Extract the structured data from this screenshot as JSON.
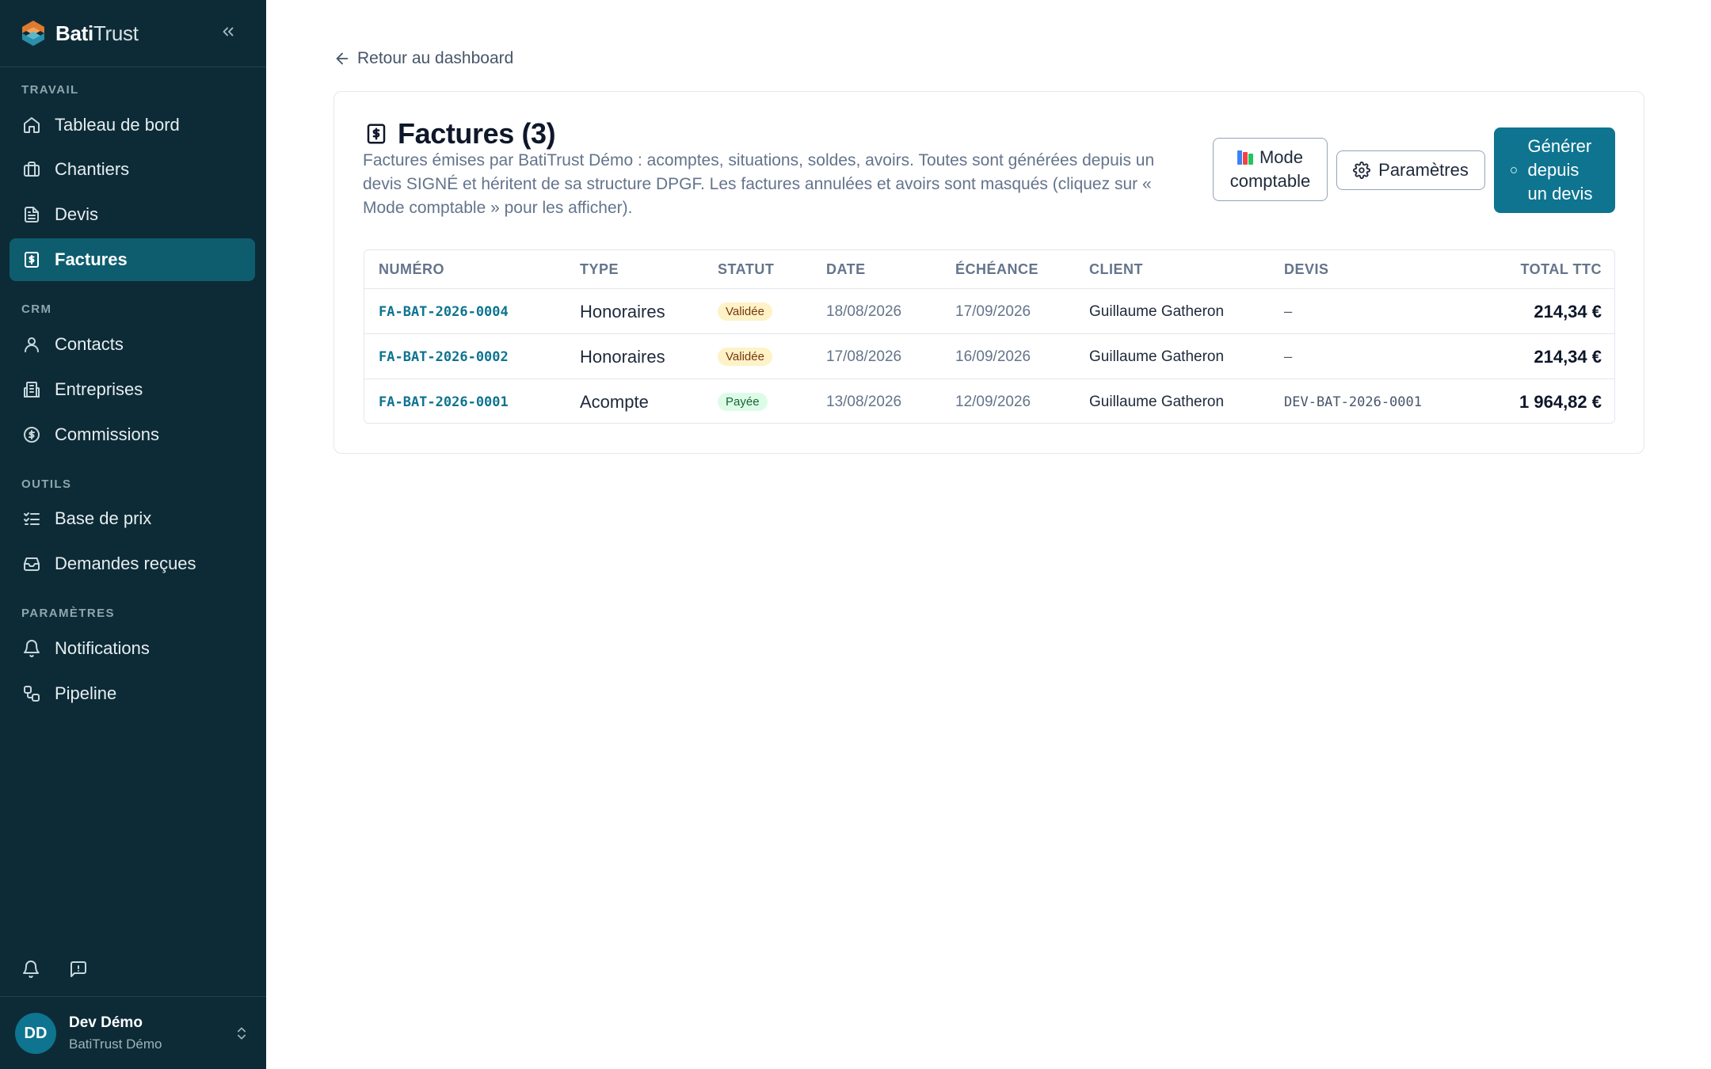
{
  "brand": {
    "name_bold": "Bati",
    "name_light": "Trust"
  },
  "sidebar": {
    "sections": [
      {
        "title": "TRAVAIL",
        "items": [
          {
            "label": "Tableau de bord",
            "icon": "home-icon"
          },
          {
            "label": "Chantiers",
            "icon": "briefcase-icon"
          },
          {
            "label": "Devis",
            "icon": "document-icon"
          },
          {
            "label": "Factures",
            "icon": "receipt-icon",
            "active": true
          }
        ]
      },
      {
        "title": "CRM",
        "items": [
          {
            "label": "Contacts",
            "icon": "user-icon"
          },
          {
            "label": "Entreprises",
            "icon": "building-icon"
          },
          {
            "label": "Commissions",
            "icon": "dollar-circle-icon"
          }
        ]
      },
      {
        "title": "OUTILS",
        "items": [
          {
            "label": "Base de prix",
            "icon": "list-checks-icon"
          },
          {
            "label": "Demandes reçues",
            "icon": "inbox-icon"
          }
        ]
      },
      {
        "title": "PARAMÈTRES",
        "items": [
          {
            "label": "Notifications",
            "icon": "bell-icon"
          },
          {
            "label": "Pipeline",
            "icon": "workflow-icon"
          }
        ]
      }
    ],
    "user": {
      "initials": "DD",
      "name": "Dev Démo",
      "org": "BatiTrust Démo"
    }
  },
  "main": {
    "back_label": "Retour au dashboard",
    "title": "Factures (3)",
    "description": "Factures émises par BatiTrust Démo : acomptes, situations, soldes, avoirs. Toutes sont générées depuis un devis SIGNÉ et héritent de sa structure DPGF. Les factures annulées et avoirs sont masqués (cliquez sur « Mode comptable » pour les afficher).",
    "buttons": {
      "mode_line1": "Mode",
      "mode_line2": "comptable",
      "params": "Paramètres",
      "generate": "Générer depuis un devis"
    },
    "table": {
      "headers": {
        "numero": "NUMÉRO",
        "type": "TYPE",
        "statut": "STATUT",
        "date": "DATE",
        "echeance": "ÉCHÉANCE",
        "client": "CLIENT",
        "devis": "DEVIS",
        "total": "TOTAL TTC"
      },
      "rows": [
        {
          "numero": "FA-BAT-2026-0004",
          "type": "Honoraires",
          "statut": "Validée",
          "statut_kind": "validee",
          "date": "18/08/2026",
          "echeance": "17/09/2026",
          "client": "Guillaume Gatheron",
          "devis": "–",
          "total": "214,34 €"
        },
        {
          "numero": "FA-BAT-2026-0002",
          "type": "Honoraires",
          "statut": "Validée",
          "statut_kind": "validee",
          "date": "17/08/2026",
          "echeance": "16/09/2026",
          "client": "Guillaume Gatheron",
          "devis": "–",
          "total": "214,34 €"
        },
        {
          "numero": "FA-BAT-2026-0001",
          "type": "Acompte",
          "statut": "Payée",
          "statut_kind": "payee",
          "date": "13/08/2026",
          "echeance": "12/09/2026",
          "client": "Guillaume Gatheron",
          "devis": "DEV-BAT-2026-0001",
          "total": "1 964,82 €"
        }
      ]
    }
  },
  "colors": {
    "sidebar_bg": "#0d2b36",
    "accent": "#0e7490",
    "active_nav": "#0e5d6f"
  }
}
